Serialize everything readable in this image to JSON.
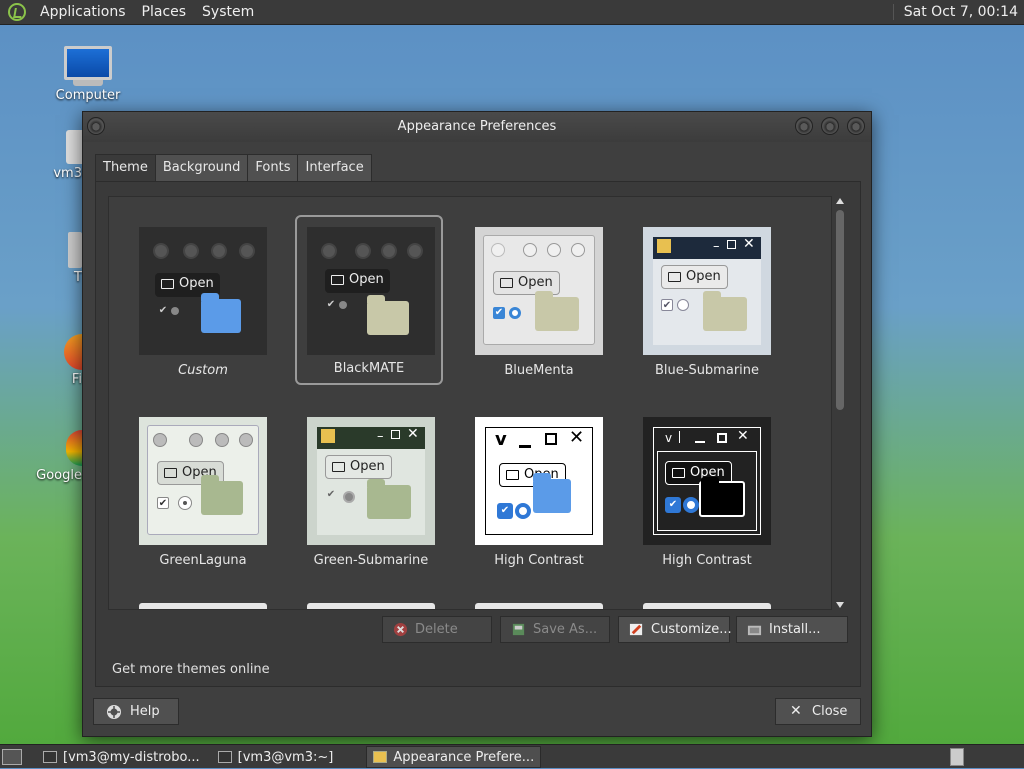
{
  "top_panel": {
    "menus": [
      "Applications",
      "Places",
      "System"
    ],
    "clock": "Sat Oct  7, 00:14"
  },
  "desktop": {
    "icons": [
      {
        "label": "Computer"
      },
      {
        "label": "vm3"
      },
      {
        "label": "T"
      },
      {
        "label": "Fi"
      },
      {
        "label": "Google"
      }
    ]
  },
  "dialog": {
    "title": "Appearance Preferences",
    "tabs": [
      "Theme",
      "Background",
      "Fonts",
      "Interface"
    ],
    "active_tab": "Theme",
    "themes": [
      {
        "name": "Custom",
        "italic": true
      },
      {
        "name": "BlackMATE",
        "selected": true
      },
      {
        "name": "BlueMenta"
      },
      {
        "name": "Blue-Submarine"
      },
      {
        "name": "GreenLaguna"
      },
      {
        "name": "Green-Submarine"
      },
      {
        "name": "High Contrast"
      },
      {
        "name": "High Contrast"
      }
    ],
    "preview_open_label": "Open",
    "buttons": {
      "delete": "Delete",
      "save_as": "Save As...",
      "customize": "Customize...",
      "install": "Install..."
    },
    "get_more": "Get more themes online",
    "help": "Help",
    "close": "Close"
  },
  "taskbar": {
    "tasks": [
      "[vm3@my-distrobo...",
      "[vm3@vm3:~]",
      "Appearance Prefere..."
    ],
    "active_task": 2
  },
  "colors": {
    "panel_bg": "#3a3a3a",
    "dialog_bg": "#3f3f3f",
    "mate_green": "#8bc34a",
    "folder_blue": "#5b9be8",
    "folder_khaki": "#c8c8a8",
    "check_blue": "#2f78d6"
  }
}
